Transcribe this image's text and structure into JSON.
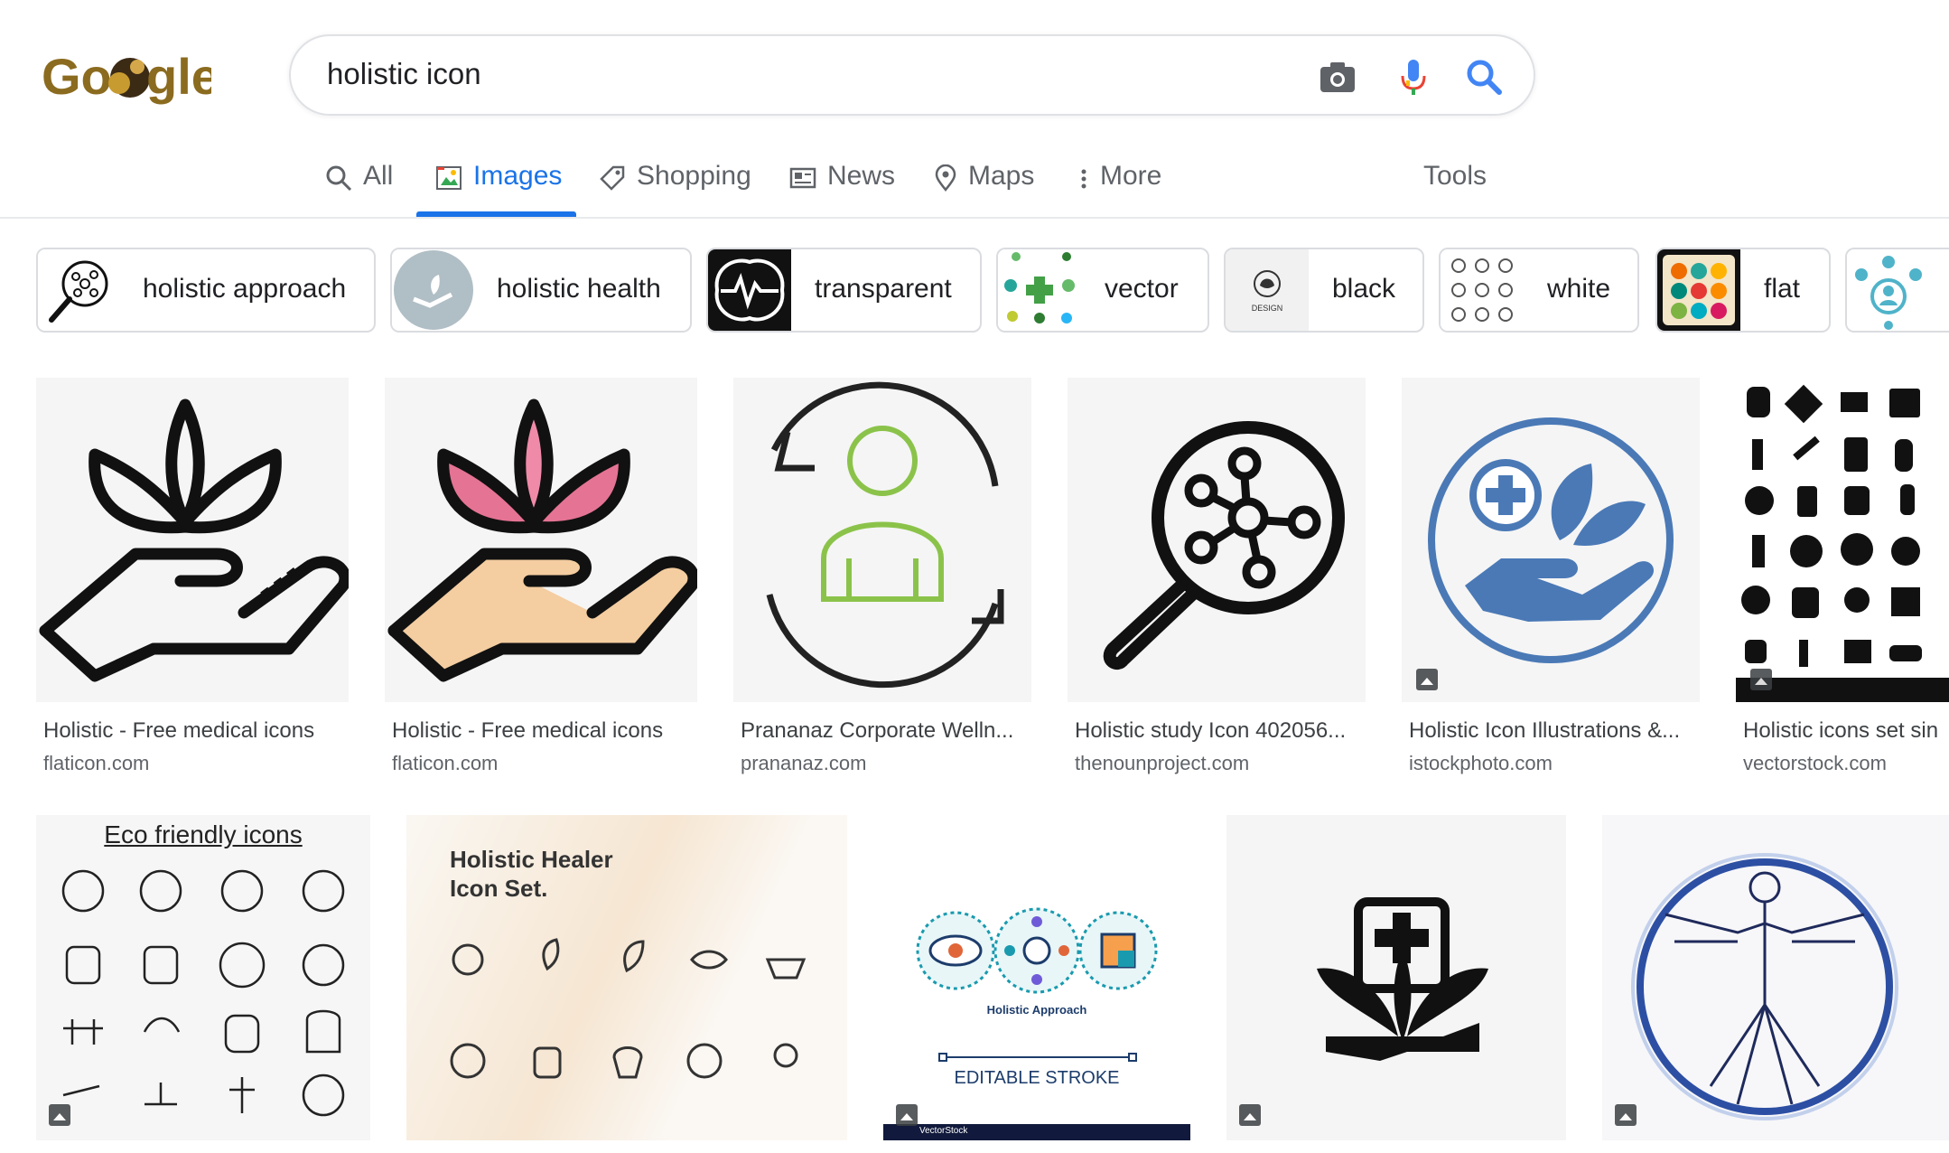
{
  "logo": {
    "text": "Google",
    "colors": [
      "#8b6b1f",
      "#6a4e12",
      "#c79b2f"
    ]
  },
  "search": {
    "query": "holistic icon"
  },
  "tabs": [
    {
      "label": "All"
    },
    {
      "label": "Images"
    },
    {
      "label": "Shopping"
    },
    {
      "label": "News"
    },
    {
      "label": "Maps"
    },
    {
      "label": "More"
    }
  ],
  "tools_label": "Tools",
  "chips": [
    {
      "label": "holistic approach",
      "icon": "magnifier-network-icon"
    },
    {
      "label": "holistic health",
      "icon": "hand-leaf-icon"
    },
    {
      "label": "transparent",
      "icon": "brain-icon"
    },
    {
      "label": "vector",
      "icon": "leaf-cross-icon"
    },
    {
      "label": "black",
      "icon": "lotus-logo-icon"
    },
    {
      "label": "white",
      "icon": "icon-grid-icon"
    },
    {
      "label": "flat",
      "icon": "colored-circles-icon"
    },
    {
      "label": "",
      "icon": "person-network-icon"
    }
  ],
  "results_row1": [
    {
      "title": "Holistic - Free medical icons",
      "source": "flaticon.com"
    },
    {
      "title": "Holistic - Free medical icons",
      "source": "flaticon.com"
    },
    {
      "title": "Prananaz Corporate Welln...",
      "source": "prananaz.com"
    },
    {
      "title": "Holistic study Icon 402056...",
      "source": "thenounproject.com"
    },
    {
      "title": "Holistic Icon Illustrations &...",
      "source": "istockphoto.com"
    },
    {
      "title": "Holistic icons set sin",
      "source": "vectorstock.com"
    }
  ],
  "results_row2": [
    {
      "caption": "Eco friendly icons"
    },
    {
      "caption_line1": "Holistic Healer",
      "caption_line2": "Icon Set."
    },
    {
      "caption": "Holistic Approach",
      "caption2": "EDITABLE STROKE",
      "watermark": "VectorStock"
    },
    {
      "caption": ""
    },
    {
      "caption": ""
    }
  ],
  "colors": {
    "accent": "#1a73e8",
    "text_secondary": "#5f6368",
    "chip_border": "#dadce0"
  }
}
